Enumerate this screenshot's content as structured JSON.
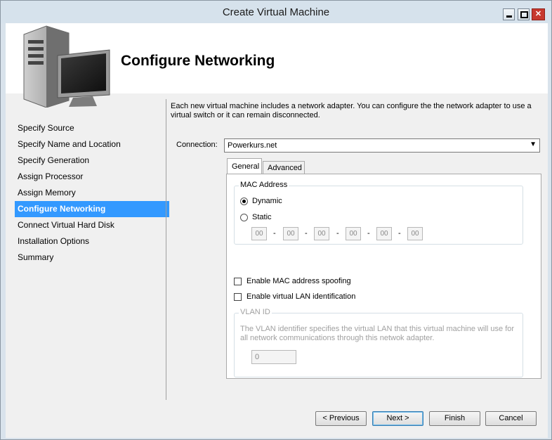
{
  "window": {
    "title": "Create Virtual Machine"
  },
  "header": {
    "title": "Configure Networking"
  },
  "nav": {
    "items": [
      "Specify Source",
      "Specify Name and Location",
      "Specify Generation",
      "Assign Processor",
      "Assign Memory",
      "Configure Networking",
      "Connect Virtual Hard Disk",
      "Installation Options",
      "Summary"
    ],
    "active_index": 5
  },
  "description": "Each new virtual machine includes a network adapter. You can configure the the network adapter to use a virtual switch or it can remain disconnected.",
  "connection": {
    "label": "Connection:",
    "value": "Powerkurs.net"
  },
  "tabs": [
    "General",
    "Advanced"
  ],
  "mac": {
    "group_title": "MAC Address",
    "dynamic_label": "Dynamic",
    "static_label": "Static",
    "selected": "Dynamic",
    "octets": [
      "00",
      "00",
      "00",
      "00",
      "00",
      "00"
    ],
    "separator": "-"
  },
  "options": {
    "spoofing_label": "Enable MAC address spoofing",
    "vlan_label": "Enable virtual LAN identification"
  },
  "vlan": {
    "group_title": "VLAN ID",
    "description": "The VLAN identifier specifies the virtual LAN that this virtual machine will use for all network communications through this netwok adapter.",
    "value": "0"
  },
  "buttons": {
    "previous": "< Previous",
    "next": "Next >",
    "finish": "Finish",
    "cancel": "Cancel"
  },
  "colors": {
    "selection": "#3399ff",
    "close": "#c7392f"
  }
}
